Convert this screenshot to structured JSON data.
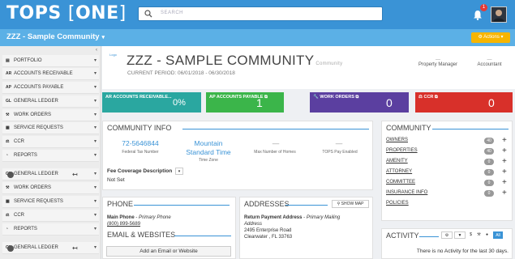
{
  "app": {
    "logo_main": "TOPS",
    "logo_bracket_left": "[",
    "logo_bracket_text": "ONE",
    "logo_bracket_right": "]"
  },
  "search": {
    "placeholder": "SEARCH"
  },
  "notifications": {
    "count": "1"
  },
  "subbar": {
    "community": "ZZZ - Sample Community",
    "actions_label": "⚙ Actions ▾"
  },
  "sidebar": {
    "items": [
      {
        "tag": "",
        "label": "PORTFOLIO"
      },
      {
        "tag": "AR",
        "label": "ACCOUNTS RECEIVABLE"
      },
      {
        "tag": "AP",
        "label": "ACCOUNTS PAYABLE"
      },
      {
        "tag": "GL",
        "label": "GENERAL LEDGER"
      },
      {
        "tag": "",
        "label": "WORK ORDERS"
      },
      {
        "tag": "",
        "label": "SERVICE REQUESTS"
      },
      {
        "tag": "",
        "label": "CCR"
      },
      {
        "tag": "",
        "label": "REPORTS"
      },
      {
        "tag": "GL",
        "label": "GENERAL LEDGER"
      },
      {
        "tag": "",
        "label": "WORK ORDERS"
      },
      {
        "tag": "",
        "label": "SERVICE REQUESTS"
      },
      {
        "tag": "",
        "label": "CCR"
      },
      {
        "tag": "",
        "label": "REPORTS"
      },
      {
        "tag": "GL",
        "label": "GENERAL LEDGER"
      }
    ]
  },
  "header": {
    "logo_text": "Logo",
    "community_name": "ZZZ - SAMPLE COMMUNITY",
    "community_suffix": "Community",
    "period": "CURRENT PERIOD: 06/01/2018 - 06/30/2018",
    "property_manager_value": "—",
    "property_manager_label": "Property Manager",
    "accountant_value": "—",
    "accountant_label": "Accountant"
  },
  "kpis": [
    {
      "label": "AR ACCOUNTS RECEIVABLE...",
      "value": "0%",
      "color": "#2aa7a0"
    },
    {
      "label": "AP ACCOUNTS PAYABLE",
      "value": "1",
      "color": "#3bb54a"
    },
    {
      "label": "WORK ORDERS",
      "value": "0",
      "color": "#5b3fa0"
    },
    {
      "label": "CCR",
      "value": "0",
      "color": "#d8302a"
    }
  ],
  "community_info": {
    "title": "COMMUNITY INFO",
    "tax_number": "72-5646844",
    "tax_label": "Federal Tax Number",
    "timezone_l1": "Mountain",
    "timezone_l2": "Standard Time",
    "timezone_label": "Time Zone",
    "max_homes": "—",
    "max_homes_label": "Max Number of Homes",
    "tops_pay": "—",
    "tops_pay_label": "TOPS Pay Enabled",
    "fee_label": "Fee Coverage Description",
    "fee_value": "Not Set"
  },
  "phone": {
    "title": "PHONE",
    "main_label": "Main Phone",
    "main_sub": "Primary Phone",
    "main_value": "(800) 899-5689"
  },
  "email": {
    "title": "EMAIL & WEBSITES",
    "add_label": "Add an Email or Website"
  },
  "addresses": {
    "title": "ADDRESSES",
    "show_map": "SHOW MAP",
    "return_label": "Return Payment Address",
    "return_sub": "Primary Mailing",
    "return_sub2": "Address",
    "line1": "2495 Enterprise Road",
    "line2": "Clearwater , FL 33763"
  },
  "community": {
    "title": "COMMUNITY",
    "rows": [
      {
        "label": "OWNERS",
        "count": "40",
        "has_plus": true
      },
      {
        "label": "PROPERTIES",
        "count": "40",
        "has_plus": true
      },
      {
        "label": "AMENITY",
        "count": "0",
        "has_plus": true
      },
      {
        "label": "ATTORNEY",
        "count": "0",
        "has_plus": true
      },
      {
        "label": "COMMITTEE",
        "count": "0",
        "has_plus": true
      },
      {
        "label": "INSURANCE INFO",
        "count": "0",
        "has_plus": true
      },
      {
        "label": "POLICIES",
        "count": "",
        "has_plus": false
      }
    ]
  },
  "activity": {
    "title": "ACTIVITY",
    "all_label": "All",
    "empty_text": "There is no Activity for the last 30 days."
  }
}
